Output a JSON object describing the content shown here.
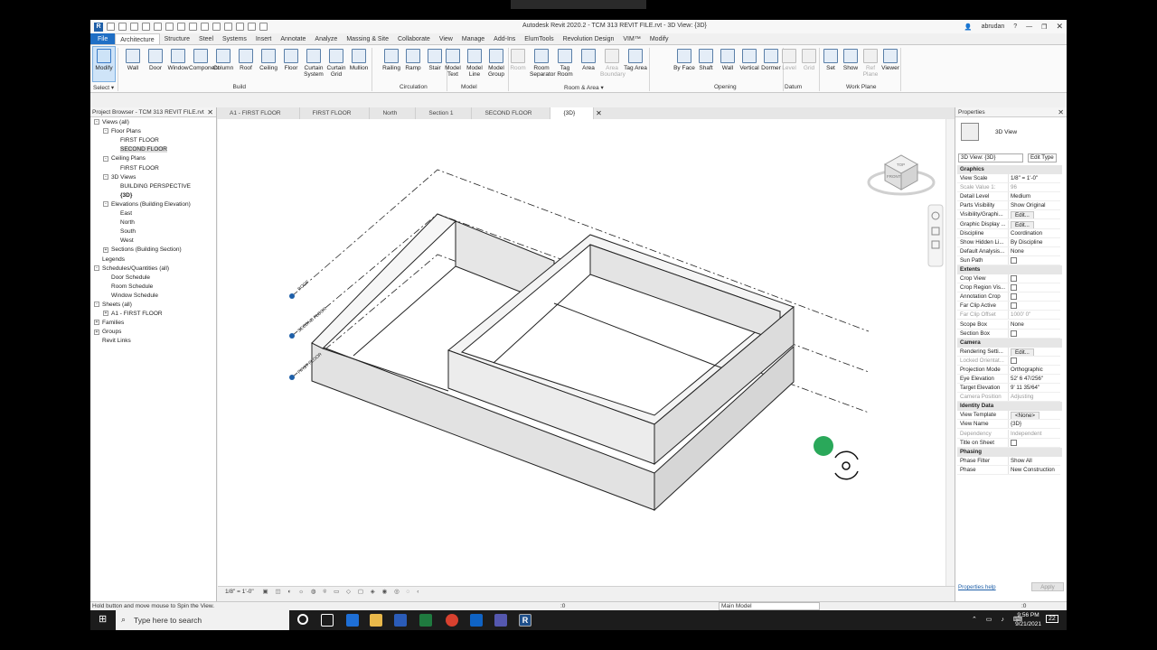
{
  "window": {
    "title": "Autodesk Revit 2020.2 - TCM 313 REVIT FILE.rvt - 3D View: {3D}",
    "user": "abrudan"
  },
  "ribbon_tabs": [
    "File",
    "Architecture",
    "Structure",
    "Steel",
    "Systems",
    "Insert",
    "Annotate",
    "Analyze",
    "Massing & Site",
    "Collaborate",
    "View",
    "Manage",
    "Add-Ins",
    "ElumTools",
    "Revolution Design",
    "VIM™",
    "Modify"
  ],
  "ribbon": {
    "select": {
      "modify": "Modify",
      "panel": "Select ▾"
    },
    "build": {
      "panel": "Build",
      "tools": [
        "Wall",
        "Door",
        "Window",
        "Component",
        "Column",
        "Roof",
        "Ceiling",
        "Floor",
        "Curtain System",
        "Curtain Grid",
        "Mullion"
      ]
    },
    "circulation": {
      "panel": "Circulation",
      "tools": [
        "Railing",
        "Ramp",
        "Stair"
      ]
    },
    "model": {
      "panel": "Model",
      "tools": [
        "Model Text",
        "Model Line",
        "Model Group"
      ]
    },
    "room_area": {
      "panel": "Room & Area ▾",
      "tools": [
        "Room",
        "Room Separator",
        "Tag Room",
        "Area",
        "Area Boundary",
        "Tag Area"
      ]
    },
    "opening": {
      "panel": "Opening",
      "tools": [
        "By Face",
        "Shaft",
        "Wall",
        "Vertical",
        "Dormer"
      ]
    },
    "datum": {
      "panel": "Datum",
      "tools": [
        "Level",
        "Grid"
      ]
    },
    "work_plane": {
      "panel": "Work Plane",
      "tools": [
        "Set",
        "Show",
        "Ref Plane",
        "Viewer"
      ]
    }
  },
  "project_browser": {
    "title": "Project Browser - TCM 313 REVIT FILE.rvt",
    "items": [
      {
        "label": "Views (all)",
        "depth": 0,
        "exp": "-"
      },
      {
        "label": "Floor Plans",
        "depth": 1,
        "exp": "-"
      },
      {
        "label": "FIRST FLOOR",
        "depth": 2,
        "exp": ""
      },
      {
        "label": "SECOND FLOOR",
        "depth": 2,
        "exp": "",
        "selected": true
      },
      {
        "label": "Ceiling Plans",
        "depth": 1,
        "exp": "-"
      },
      {
        "label": "FIRST FLOOR",
        "depth": 2,
        "exp": ""
      },
      {
        "label": "3D Views",
        "depth": 1,
        "exp": "-"
      },
      {
        "label": "BUILDING PERSPECTIVE",
        "depth": 2,
        "exp": ""
      },
      {
        "label": "{3D}",
        "depth": 2,
        "exp": "",
        "bold": true
      },
      {
        "label": "Elevations (Building Elevation)",
        "depth": 1,
        "exp": "-"
      },
      {
        "label": "East",
        "depth": 2,
        "exp": ""
      },
      {
        "label": "North",
        "depth": 2,
        "exp": ""
      },
      {
        "label": "South",
        "depth": 2,
        "exp": ""
      },
      {
        "label": "West",
        "depth": 2,
        "exp": ""
      },
      {
        "label": "Sections (Building Section)",
        "depth": 1,
        "exp": "+"
      },
      {
        "label": "Legends",
        "depth": 0,
        "exp": ""
      },
      {
        "label": "Schedules/Quantities (all)",
        "depth": 0,
        "exp": "-"
      },
      {
        "label": "Door Schedule",
        "depth": 1,
        "exp": ""
      },
      {
        "label": "Room Schedule",
        "depth": 1,
        "exp": ""
      },
      {
        "label": "Window Schedule",
        "depth": 1,
        "exp": ""
      },
      {
        "label": "Sheets (all)",
        "depth": 0,
        "exp": "-"
      },
      {
        "label": "A1 - FIRST FLOOR",
        "depth": 1,
        "exp": "+"
      },
      {
        "label": "Families",
        "depth": 0,
        "exp": "+"
      },
      {
        "label": "Groups",
        "depth": 0,
        "exp": "+"
      },
      {
        "label": "Revit Links",
        "depth": 0,
        "exp": ""
      }
    ]
  },
  "view_tabs": [
    "A1 - FIRST FLOOR",
    "FIRST FLOOR",
    "North",
    "Section 1",
    "SECOND FLOOR",
    "{3D}"
  ],
  "viewport": {
    "levels": [
      "ROOF",
      "SECOND FLOOR",
      "FIRST FLOOR"
    ],
    "viewcube": {
      "top": "TOP",
      "front": "FRONT"
    },
    "scale": "1/8\" = 1'-0\""
  },
  "properties": {
    "title": "Properties",
    "type": "3D View",
    "selector": "3D View: {3D}",
    "edit_type": "Edit Type",
    "sections": [
      {
        "name": "Graphics",
        "rows": [
          [
            "View Scale",
            "1/8\" = 1'-0\""
          ],
          [
            "Scale Value 1:",
            "96"
          ],
          [
            "Detail Level",
            "Medium"
          ],
          [
            "Parts Visibility",
            "Show Original"
          ],
          [
            "Visibility/Graphi...",
            "Edit..."
          ],
          [
            "Graphic Display ...",
            "Edit..."
          ],
          [
            "Discipline",
            "Coordination"
          ],
          [
            "Show Hidden Li...",
            "By Discipline"
          ],
          [
            "Default Analysis...",
            "None"
          ],
          [
            "Sun Path",
            ""
          ]
        ]
      },
      {
        "name": "Extents",
        "rows": [
          [
            "Crop View",
            ""
          ],
          [
            "Crop Region Vis...",
            ""
          ],
          [
            "Annotation Crop",
            ""
          ],
          [
            "Far Clip Active",
            ""
          ],
          [
            "Far Clip Offset",
            "1000' 0\""
          ],
          [
            "Scope Box",
            "None"
          ],
          [
            "Section Box",
            ""
          ]
        ]
      },
      {
        "name": "Camera",
        "rows": [
          [
            "Rendering Setti...",
            "Edit..."
          ],
          [
            "Locked Orientat...",
            ""
          ],
          [
            "Projection Mode",
            "Orthographic"
          ],
          [
            "Eye Elevation",
            "52' 6 47/256\""
          ],
          [
            "Target Elevation",
            "9' 11 35/64\""
          ],
          [
            "Camera Position",
            "Adjusting"
          ]
        ]
      },
      {
        "name": "Identity Data",
        "rows": [
          [
            "View Template",
            "<None>"
          ],
          [
            "View Name",
            "{3D}"
          ],
          [
            "Dependency",
            "Independent"
          ],
          [
            "Title on Sheet",
            ""
          ]
        ]
      },
      {
        "name": "Phasing",
        "rows": [
          [
            "Phase Filter",
            "Show All"
          ],
          [
            "Phase",
            "New Construction"
          ]
        ]
      }
    ],
    "help": "Properties help",
    "apply": "Apply"
  },
  "status": {
    "text": "Hold button and move mouse to Spin the View.",
    "workset": ":0",
    "model": "Main Model",
    "sel_count": ":0"
  },
  "taskbar": {
    "search": "Type here to search",
    "time": "9:56 PM",
    "date": "9/21/2021",
    "notif": "22"
  }
}
